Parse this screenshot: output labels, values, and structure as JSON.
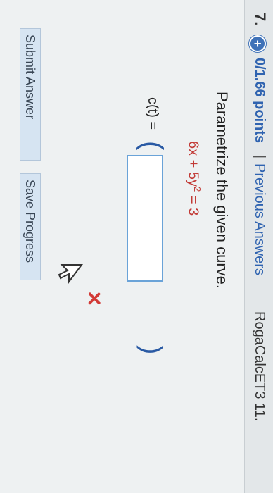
{
  "header": {
    "question_number": "7.",
    "plus_icon": "plus-icon",
    "points": "0/1.66 points",
    "separator": "|",
    "previous_answers": "Previous Answers",
    "source": "RogaCalcET3 11."
  },
  "question": {
    "prompt": "Parametrize the given curve.",
    "equation_left": "6x + 5y",
    "equation_exponent": "2",
    "equation_right": " = 3",
    "c_label": "c(t) =",
    "open_paren": "(",
    "close_paren": ")",
    "answer_value": "",
    "incorrect_mark": "✕"
  },
  "buttons": {
    "submit": "Submit Answer",
    "save": "Save Progress"
  },
  "colors": {
    "link": "#2f63b0",
    "equation": "#c23a36",
    "button_bg": "#d6e4f2",
    "input_border": "#6aa3d8"
  }
}
